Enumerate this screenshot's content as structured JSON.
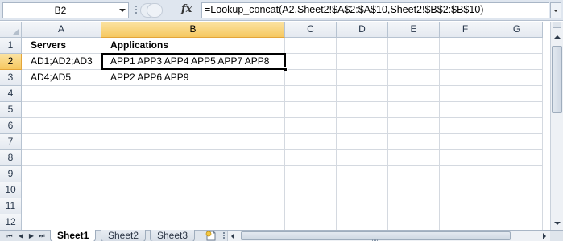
{
  "formula_bar": {
    "name_box": "B2",
    "fx_label": "fx",
    "formula": "=Lookup_concat(A2,Sheet2!$A$2:$A$10,Sheet2!$B$2:$B$10)"
  },
  "grid": {
    "active_cell": "B2",
    "columns": [
      "A",
      "B",
      "C",
      "D",
      "E",
      "F",
      "G"
    ],
    "rows": [
      "1",
      "2",
      "3",
      "4",
      "5",
      "6",
      "7",
      "8",
      "9",
      "10",
      "11",
      "12"
    ],
    "cells": {
      "A1": "Servers",
      "B1": "Applications",
      "A2": "AD1;AD2;AD3",
      "B2": "APP1 APP3 APP4 APP5 APP7 APP8",
      "A3": "AD4;AD5",
      "B3": "APP2 APP6 APP9"
    }
  },
  "sheet_tabs": {
    "tabs": [
      "Sheet1",
      "Sheet2",
      "Sheet3"
    ],
    "active": "Sheet1"
  },
  "nav_buttons": {
    "first": "⏮",
    "prev": "◀",
    "next": "▶",
    "last": "⏭"
  },
  "colors": {
    "header_selected": "#f6c860",
    "chrome": "#dfe6ef",
    "gridline": "#d4d9e0"
  },
  "icons": [
    "namebox-dropdown-icon",
    "fx-icon",
    "formula-expand-icon",
    "scroll-up-icon",
    "scroll-down-icon",
    "scroll-left-icon",
    "scroll-right-icon",
    "insert-sheet-icon"
  ]
}
